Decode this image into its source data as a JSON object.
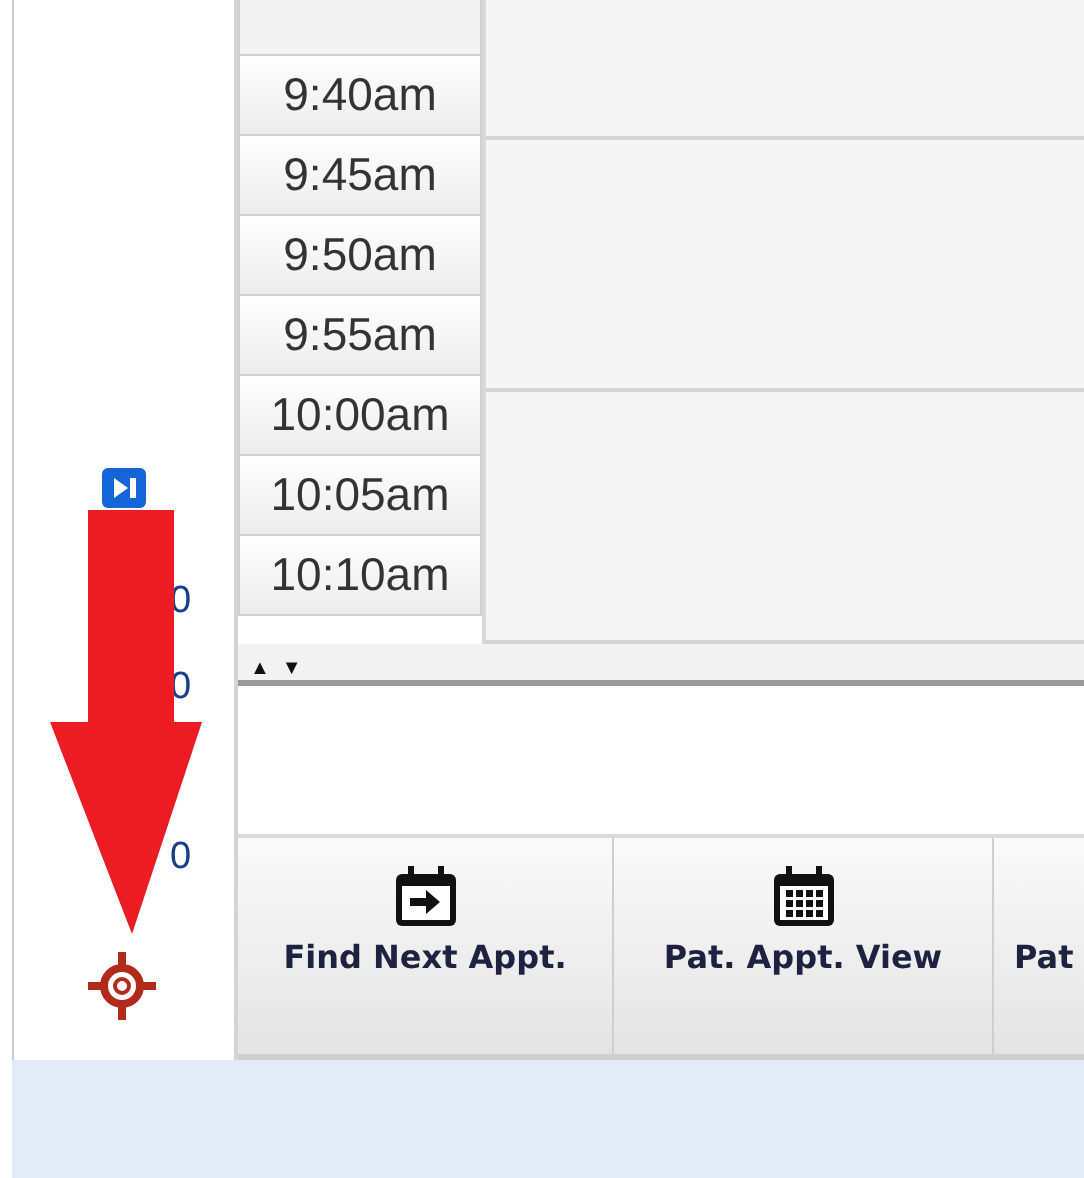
{
  "side_panel": {
    "counts": [
      "0",
      "0",
      "0"
    ]
  },
  "schedule": {
    "time_slots": [
      "9:40am",
      "9:45am",
      "9:50am",
      "9:55am",
      "10:00am",
      "10:05am",
      "10:10am"
    ],
    "scroll_arrows": [
      "▲",
      "▼"
    ]
  },
  "toolbar": [
    {
      "label": "Find Next Appt.",
      "kind": "calendar-arrow"
    },
    {
      "label": "Pat. Appt. View",
      "kind": "calendar-grid"
    },
    {
      "label": "Pat",
      "kind": "plain"
    }
  ],
  "annotation": {
    "kind": "arrow"
  }
}
